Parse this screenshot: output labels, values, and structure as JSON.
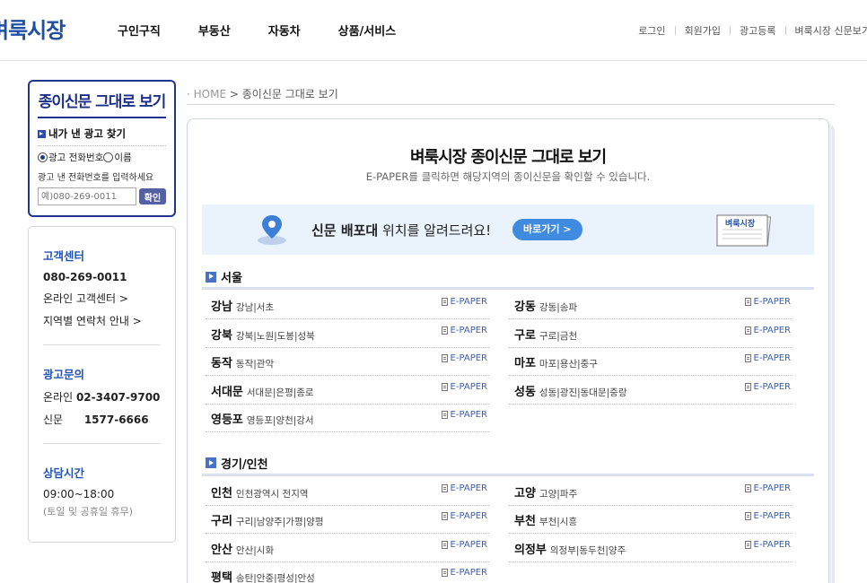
{
  "header": {
    "logo": "벼룩시장",
    "nav": [
      "구인구직",
      "부동산",
      "자동차",
      "상품/서비스"
    ],
    "util": [
      "로그인",
      "회원가입",
      "광고등록",
      "벼룩시장 신문보기"
    ]
  },
  "paper_box": {
    "title": "종이신문 그대로 보기",
    "find_title": "내가 낸 광고 찾기",
    "radio_phone": "광고 전화번호",
    "radio_name": "이름",
    "hint": "광고 낸 전화번호를 입력하세요",
    "input_placeholder": "예)080-269-0011",
    "confirm_label": "확인"
  },
  "customer": {
    "cs_title": "고객센터",
    "cs_phone": "080-269-0011",
    "cs_online": "온라인 고객센터 >",
    "cs_regional": "지역별 연락처 안내 >",
    "ad_title": "광고문의",
    "ad_online_label": "온라인",
    "ad_online_phone": "02-3407-9700",
    "ad_paper_label": "신문",
    "ad_paper_phone": "1577-6666",
    "hours_title": "상담시간",
    "hours": "09:00~18:00",
    "hours_note": "(토일 및 공휴일 휴무)"
  },
  "breadcrumb": {
    "home": "HOME",
    "current": "종이신문 그대로 보기"
  },
  "main": {
    "title": "벼룩시장 종이신문 그대로 보기",
    "desc": "E-PAPER를 클릭하면 해당지역의 종이신문을 확인할 수 있습니다.",
    "banner_bold": "신문 배포대",
    "banner_rest": " 위치를 알려드려요!",
    "banner_button": "바로가기 >",
    "paper_label": "벼룩시장",
    "epaper": "E-PAPER"
  },
  "regions": [
    {
      "name": "서울",
      "items": [
        {
          "name": "강남",
          "areas": "강남|서초"
        },
        {
          "name": "강동",
          "areas": "강동|송파"
        },
        {
          "name": "강북",
          "areas": "강북|노원|도봉|성북"
        },
        {
          "name": "구로",
          "areas": "구로|금천"
        },
        {
          "name": "동작",
          "areas": "동작|관악"
        },
        {
          "name": "마포",
          "areas": "마포|용산|중구"
        },
        {
          "name": "서대문",
          "areas": "서대문|은평|종로"
        },
        {
          "name": "성동",
          "areas": "성동|광진|동대문|중랑"
        },
        {
          "name": "영등포",
          "areas": "영등포|양천|강서"
        }
      ]
    },
    {
      "name": "경기/인천",
      "items": [
        {
          "name": "인천",
          "areas": "인천광역시 전지역"
        },
        {
          "name": "고양",
          "areas": "고양|파주"
        },
        {
          "name": "구리",
          "areas": "구리|남양주|가평|양평"
        },
        {
          "name": "부천",
          "areas": "부천|시흥"
        },
        {
          "name": "안산",
          "areas": "안산|시화"
        },
        {
          "name": "의정부",
          "areas": "의정부|동두천|양주"
        },
        {
          "name": "평택",
          "areas": "송탄|안중|평성|안성"
        }
      ]
    }
  ]
}
